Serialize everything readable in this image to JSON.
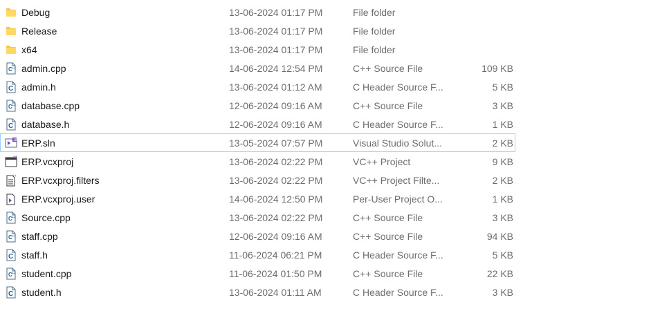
{
  "files": [
    {
      "name": "Debug",
      "date": "13-06-2024 01:17 PM",
      "type": "File folder",
      "size": "",
      "icon": "folder-icon"
    },
    {
      "name": "Release",
      "date": "13-06-2024 01:17 PM",
      "type": "File folder",
      "size": "",
      "icon": "folder-icon"
    },
    {
      "name": "x64",
      "date": "13-06-2024 01:17 PM",
      "type": "File folder",
      "size": "",
      "icon": "folder-icon"
    },
    {
      "name": "admin.cpp",
      "date": "14-06-2024 12:54 PM",
      "type": "C++ Source File",
      "size": "109 KB",
      "icon": "cpp-file-icon"
    },
    {
      "name": "admin.h",
      "date": "13-06-2024 01:12 AM",
      "type": "C Header Source F...",
      "size": "5 KB",
      "icon": "header-file-icon"
    },
    {
      "name": "database.cpp",
      "date": "12-06-2024 09:16 AM",
      "type": "C++ Source File",
      "size": "3 KB",
      "icon": "cpp-file-icon"
    },
    {
      "name": "database.h",
      "date": "12-06-2024 09:16 AM",
      "type": "C Header Source F...",
      "size": "1 KB",
      "icon": "header-file-icon"
    },
    {
      "name": "ERP.sln",
      "date": "13-05-2024 07:57 PM",
      "type": "Visual Studio Solut...",
      "size": "2 KB",
      "icon": "vs-solution-icon"
    },
    {
      "name": "ERP.vcxproj",
      "date": "13-06-2024 02:22 PM",
      "type": "VC++ Project",
      "size": "9 KB",
      "icon": "vcxproj-icon"
    },
    {
      "name": "ERP.vcxproj.filters",
      "date": "13-06-2024 02:22 PM",
      "type": "VC++ Project Filte...",
      "size": "2 KB",
      "icon": "filters-file-icon"
    },
    {
      "name": "ERP.vcxproj.user",
      "date": "14-06-2024 12:50 PM",
      "type": "Per-User Project O...",
      "size": "1 KB",
      "icon": "user-file-icon"
    },
    {
      "name": "Source.cpp",
      "date": "13-06-2024 02:22 PM",
      "type": "C++ Source File",
      "size": "3 KB",
      "icon": "cpp-file-icon"
    },
    {
      "name": "staff.cpp",
      "date": "12-06-2024 09:16 AM",
      "type": "C++ Source File",
      "size": "94 KB",
      "icon": "cpp-file-icon"
    },
    {
      "name": "staff.h",
      "date": "11-06-2024 06:21 PM",
      "type": "C Header Source F...",
      "size": "5 KB",
      "icon": "header-file-icon"
    },
    {
      "name": "student.cpp",
      "date": "11-06-2024 01:50 PM",
      "type": "C++ Source File",
      "size": "22 KB",
      "icon": "cpp-file-icon"
    },
    {
      "name": "student.h",
      "date": "13-06-2024 01:11 AM",
      "type": "C Header Source F...",
      "size": "3 KB",
      "icon": "header-file-icon"
    }
  ],
  "selected_index": 7,
  "colors": {
    "folder": "#f5c84c",
    "file_outline": "#4a6b8a",
    "vs_purple": "#7a3fb8",
    "selection_border": "#99d1ff"
  }
}
